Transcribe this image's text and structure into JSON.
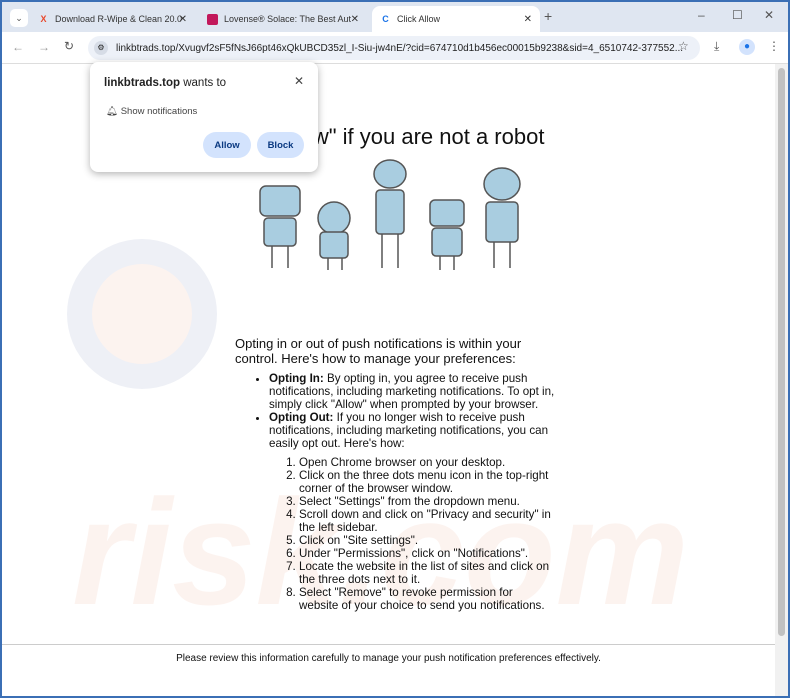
{
  "tabs": [
    {
      "title": "Download R-Wipe & Clean 20.0",
      "icon": "x-logo-icon",
      "color": "#e8472b"
    },
    {
      "title": "Lovense® Solace: The Best Aut",
      "icon": "lovense-icon",
      "color": "#c2185b"
    },
    {
      "title": "Click Allow",
      "icon": "loading-icon",
      "color": "#1a73e8",
      "active": true
    }
  ],
  "url": "linkbtrads.top/Xvugvf2sF5fNsJ66pt46xQkUBCD35zl_I-Siu-jw4nE/?cid=674710d1b456ec00015b9238&sid=4_6510742-377552...",
  "popup": {
    "site": "linkbtrads.top",
    "wants": " wants to",
    "permission": "Show notifications",
    "allow": "Allow",
    "block": "Block"
  },
  "page": {
    "heading": "Click \"Allow\" if you are not a robot",
    "intro": "Opting in or out of push notifications is within your control. Here's how to manage your preferences:",
    "bullets": [
      {
        "label": "Opting In:",
        "text": " By opting in, you agree to receive push notifications, including marketing notifications. To opt in, simply click \"Allow\" when prompted by your browser."
      },
      {
        "label": "Opting Out:",
        "text": " If you no longer wish to receive push notifications, including marketing notifications, you can easily opt out. Here's how:"
      }
    ],
    "steps": [
      "Open Chrome browser on your desktop.",
      "Click on the three dots menu icon in the top-right corner of the browser window.",
      "Select \"Settings\" from the dropdown menu.",
      "Scroll down and click on \"Privacy and security\" in the left sidebar.",
      "Click on \"Site settings\".",
      "Under \"Permissions\", click on \"Notifications\".",
      "Locate the website in the list of sites and click on the three dots next to it.",
      "Select \"Remove\" to revoke permission for website of your choice to send you notifications."
    ],
    "footer": "Please review this information carefully to manage your push notification preferences effectively."
  }
}
